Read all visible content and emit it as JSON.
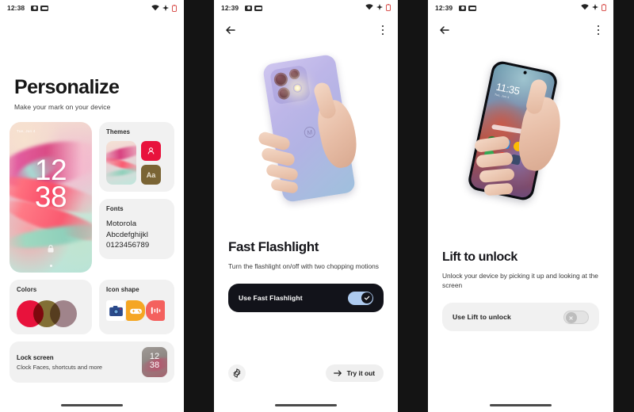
{
  "screens": {
    "left": {
      "status": {
        "time": "12:38",
        "icons": [
          "video-notification-icon",
          "message-notification-icon",
          "wifi-icon",
          "signal-icon",
          "battery-icon"
        ]
      },
      "title": "Personalize",
      "subtitle": "Make your mark on your device",
      "wallpaper_preview": {
        "name": "wallpaper-preview",
        "date": "Tue, Jun 4",
        "clock_hours": "12",
        "clock_minutes": "38",
        "lock_icon": "lock-icon"
      },
      "cards": {
        "themes": {
          "title": "Themes",
          "tiles": [
            {
              "icon": "person-icon",
              "color": "#e8123c"
            },
            {
              "label": "Aa",
              "color": "#7a6434"
            }
          ]
        },
        "fonts": {
          "title": "Fonts",
          "sample_line1": "Motorola",
          "sample_line2": "Abcdefghijkl",
          "sample_line3": "0123456789"
        },
        "colors": {
          "title": "Colors",
          "swatches": [
            "#e8123c",
            "#8a7538",
            "#a98c93"
          ]
        },
        "icon_shape": {
          "title": "Icon shape",
          "icons": [
            "camera-icon",
            "game-controller-icon",
            "audio-waveform-icon"
          ]
        },
        "lock_screen": {
          "title": "Lock screen",
          "subtitle": "Clock Faces, shortcuts and more",
          "thumb_hours": "12",
          "thumb_minutes": "38"
        }
      }
    },
    "middle": {
      "status": {
        "time": "12:39"
      },
      "toolbar": {
        "back": "back-arrow-icon",
        "menu": "overflow-menu-icon"
      },
      "hero_alt": "hand-holding-phone-with-flashlight-on",
      "title": "Fast Flashlight",
      "description": "Turn the flashlight on/off with two chopping motions",
      "toggle": {
        "label": "Use Fast Flashlight",
        "state": "on",
        "track_color": "#aecbf0",
        "row_color": "#12131a"
      },
      "gear_button": "settings-gear-icon",
      "try_button": {
        "label": "Try it out",
        "icon": "arrow-right-icon"
      }
    },
    "right": {
      "status": {
        "time": "12:39"
      },
      "toolbar": {
        "back": "back-arrow-icon",
        "menu": "overflow-menu-icon"
      },
      "hero_alt": "hand-holding-phone-showing-lock-screen",
      "phone_clock": "11:35",
      "phone_meta": "Tue, Jun 4",
      "title": "Lift to unlock",
      "description": "Unlock your device by picking it up and looking at the screen",
      "toggle": {
        "label": "Use Lift to unlock",
        "state": "off",
        "track_color": "#e3e3e3",
        "row_color": "#f1f1f1"
      }
    }
  }
}
